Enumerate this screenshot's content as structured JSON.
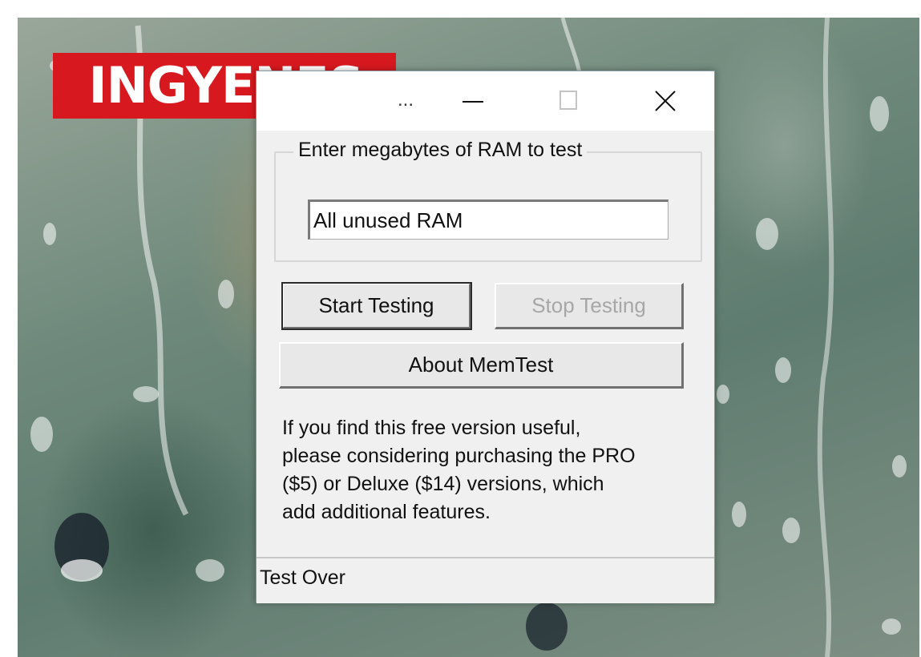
{
  "badge": {
    "text": "INGYENES"
  },
  "window": {
    "title_visible": "...",
    "controls": {
      "minimize": "minimize-icon",
      "maximize": "maximize-icon",
      "close": "close-icon"
    },
    "group_label": "Enter megabytes of RAM to test",
    "ram_input_value": "All unused RAM",
    "start_button": "Start Testing",
    "stop_button": "Stop Testing",
    "about_button": "About MemTest",
    "info_lines": [
      "If you find this free version useful,",
      "please considering purchasing the PRO",
      "($5) or Deluxe ($14) versions, which",
      "add additional features."
    ],
    "status": "Test Over"
  },
  "colors": {
    "badge": "#d7191f",
    "window_bg": "#f0f0f0",
    "disabled_text": "#a7a7a7"
  }
}
